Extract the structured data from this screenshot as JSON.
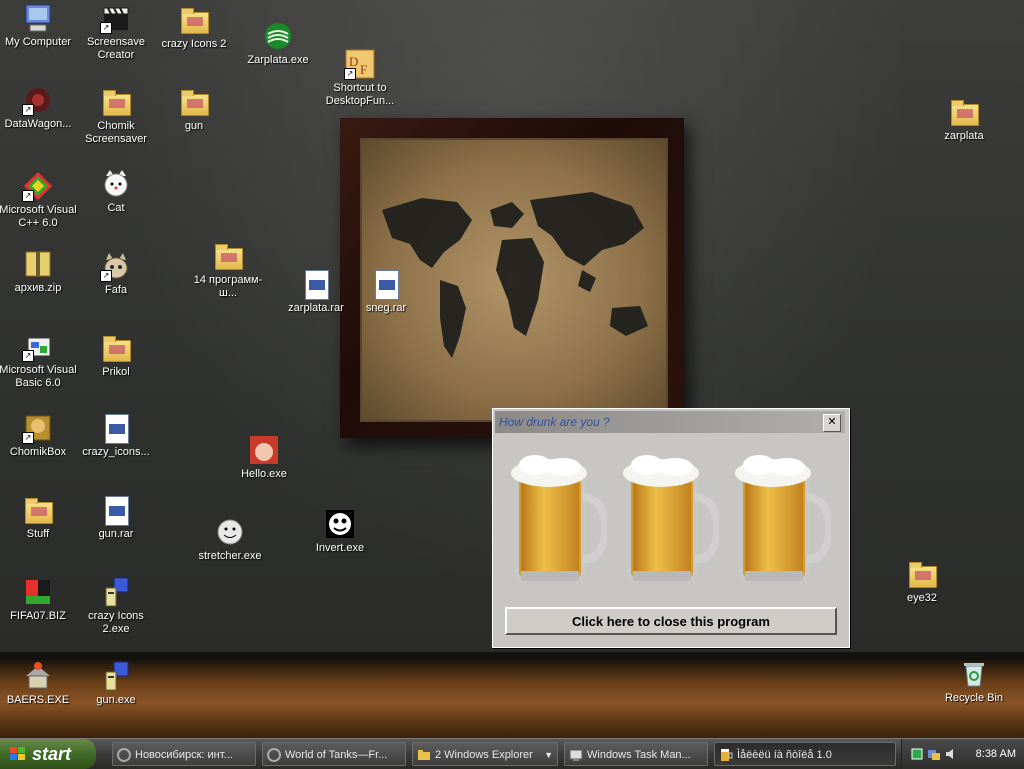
{
  "desktop": {
    "icons": [
      {
        "id": "my-computer",
        "label": "My Computer"
      },
      {
        "id": "screensave-creator",
        "label": "Screensave Creator"
      },
      {
        "id": "crazy-icons-2",
        "label": "crazy Icons 2"
      },
      {
        "id": "zarplata-exe",
        "label": "Zarplata.exe"
      },
      {
        "id": "shortcut-desktopfun",
        "label": "Shortcut to DesktopFun..."
      },
      {
        "id": "datawagon",
        "label": "DataWagon..."
      },
      {
        "id": "chomik-screensaver",
        "label": "Chomik Screensaver"
      },
      {
        "id": "gun-folder",
        "label": "gun"
      },
      {
        "id": "zarplata-folder",
        "label": "zarplata"
      },
      {
        "id": "ms-visual-cpp",
        "label": "Microsoft Visual C++ 6.0"
      },
      {
        "id": "cat",
        "label": "Cat"
      },
      {
        "id": "programs-14",
        "label": "14 программ-ш..."
      },
      {
        "id": "zarplata-rar",
        "label": "zarplata.rar"
      },
      {
        "id": "sneg-rar",
        "label": "sneg.rar"
      },
      {
        "id": "arhiv-zip",
        "label": "архив.zip"
      },
      {
        "id": "fafa",
        "label": "Fafa"
      },
      {
        "id": "ms-visual-basic",
        "label": "Microsoft Visual Basic 6.0"
      },
      {
        "id": "prikol",
        "label": "Prikol"
      },
      {
        "id": "chomikbox",
        "label": "ChomikBox"
      },
      {
        "id": "crazy-icons-file",
        "label": "crazy_icons..."
      },
      {
        "id": "hello-exe",
        "label": "Hello.exe"
      },
      {
        "id": "stuff",
        "label": "Stuff"
      },
      {
        "id": "gun-rar",
        "label": "gun.rar"
      },
      {
        "id": "stretcher-exe",
        "label": "stretcher.exe"
      },
      {
        "id": "invert-exe",
        "label": "Invert.exe"
      },
      {
        "id": "eye32",
        "label": "eye32"
      },
      {
        "id": "fifa-biz",
        "label": "FIFA07.BIZ"
      },
      {
        "id": "crazy-icons-2-exe",
        "label": "crazy Icons 2.exe"
      },
      {
        "id": "baers-exe",
        "label": "BAERS.EXE"
      },
      {
        "id": "gun-exe",
        "label": "gun.exe"
      },
      {
        "id": "recycle-bin",
        "label": "Recycle Bin"
      }
    ]
  },
  "window": {
    "title": "How drunk are you ?",
    "close_glyph": "✕",
    "close_program_label": "Click here to close this program",
    "mug_count": 3
  },
  "taskbar": {
    "start_label": "start",
    "tasks": [
      {
        "label": "Новосибирск: инт..."
      },
      {
        "label": "World of Tanks—Fr..."
      },
      {
        "label": "2 Windows Explorer"
      },
      {
        "label": "Windows Task Man..."
      },
      {
        "label": "Ìåëèëü íà ñòîëå 1.0"
      }
    ],
    "clock": "8:38 AM"
  },
  "colors": {
    "accent": "#3f6a28",
    "title_text": "#3050a0"
  }
}
